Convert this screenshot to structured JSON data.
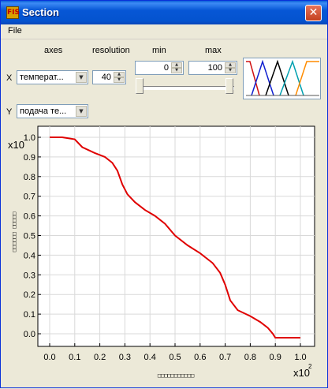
{
  "window": {
    "title": "Section",
    "icon_text": "FIS",
    "close_glyph": "✕"
  },
  "menu": {
    "file": "File"
  },
  "headers": {
    "axes": "axes",
    "resolution": "resolution",
    "min": "min",
    "max": "max"
  },
  "x_axis_row": {
    "label": "X",
    "selected": "температ..."
  },
  "y_axis_row": {
    "label": "Y",
    "selected": "подача те..."
  },
  "resolution_value": "40",
  "min_value": "0",
  "max_value": "100",
  "slider": {
    "lower_fraction": 0.0,
    "upper_fraction": 1.0
  },
  "colors": {
    "curve": "#e00000",
    "grid": "#d9d9d9",
    "mini_red": "#d01010",
    "mini_blue": "#1020d0",
    "mini_black": "#000000",
    "mini_cyan": "#00a0b0",
    "mini_orange": "#ff8c00"
  },
  "chart_data": {
    "type": "line",
    "x": [
      0.0,
      0.05,
      0.1,
      0.13,
      0.18,
      0.22,
      0.25,
      0.27,
      0.29,
      0.31,
      0.34,
      0.38,
      0.42,
      0.46,
      0.5,
      0.55,
      0.6,
      0.65,
      0.68,
      0.7,
      0.72,
      0.75,
      0.8,
      0.84,
      0.87,
      0.89,
      0.9,
      0.95,
      1.0
    ],
    "y": [
      1.0,
      1.0,
      0.99,
      0.95,
      0.92,
      0.9,
      0.87,
      0.83,
      0.76,
      0.71,
      0.67,
      0.63,
      0.6,
      0.56,
      0.5,
      0.45,
      0.41,
      0.36,
      0.31,
      0.25,
      0.17,
      0.12,
      0.09,
      0.06,
      0.03,
      0.0,
      -0.02,
      -0.02,
      -0.02
    ],
    "xlim": [
      0.0,
      1.0
    ],
    "ylim": [
      -0.05,
      1.03
    ],
    "xticks": [
      "0.0",
      "0.1",
      "0.2",
      "0.3",
      "0.4",
      "0.5",
      "0.6",
      "0.7",
      "0.8",
      "0.9",
      "1.0"
    ],
    "yticks": [
      "0.0",
      "0.1",
      "0.2",
      "0.3",
      "0.4",
      "0.5",
      "0.6",
      "0.7",
      "0.8",
      "0.9",
      "1.0"
    ],
    "y_multiplier": "x10",
    "x_multiplier": "x10",
    "x_multiplier_exp": "2",
    "xlabel": "□□□□□□□□□□□",
    "ylabel": "□□□□□□ □□□□□",
    "grid": true
  }
}
